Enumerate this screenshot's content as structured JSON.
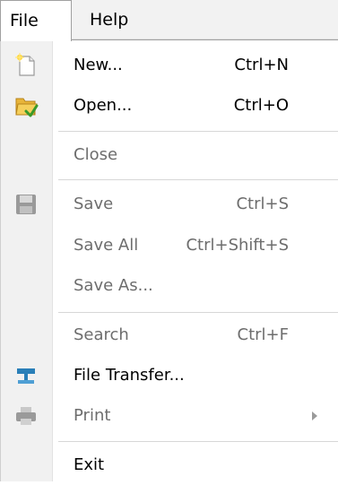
{
  "menubar": {
    "file_label": "File",
    "help_label": "Help"
  },
  "file_menu": {
    "new": {
      "label": "New...",
      "shortcut": "Ctrl+N",
      "icon": "new-document-icon"
    },
    "open": {
      "label": "Open...",
      "shortcut": "Ctrl+O",
      "icon": "open-folder-icon"
    },
    "close": {
      "label": "Close"
    },
    "save": {
      "label": "Save",
      "shortcut": "Ctrl+S",
      "icon": "save-icon"
    },
    "save_all": {
      "label": "Save All",
      "shortcut": "Ctrl+Shift+S"
    },
    "save_as": {
      "label": "Save As..."
    },
    "search": {
      "label": "Search",
      "shortcut": "Ctrl+F"
    },
    "file_transfer": {
      "label": "File Transfer...",
      "icon": "network-transfer-icon"
    },
    "print": {
      "label": "Print",
      "icon": "printer-icon"
    },
    "exit": {
      "label": "Exit"
    }
  },
  "colors": {
    "disabled_text": "#6d6d6d",
    "icon_strip": "#f1f1f1",
    "separator": "#d7d7d7"
  }
}
